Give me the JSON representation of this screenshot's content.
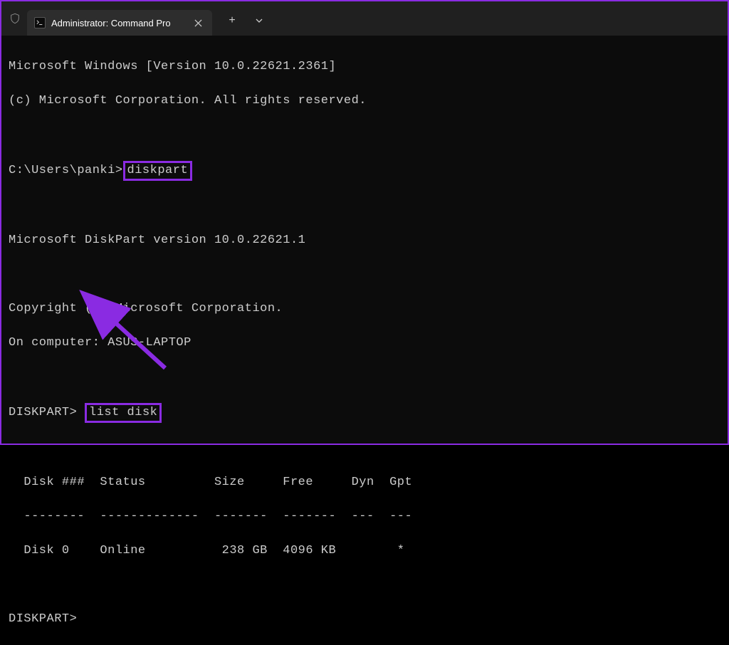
{
  "window": {
    "tab_title": "Administrator: Command Pro",
    "new_tab_symbol": "+",
    "dropdown_symbol": "⌄",
    "close_symbol": "✕"
  },
  "terminal": {
    "line1": "Microsoft Windows [Version 10.0.22621.2361]",
    "line2": "(c) Microsoft Corporation. All rights reserved.",
    "prompt1_path": "C:\\Users\\panki>",
    "prompt1_cmd": "diskpart",
    "diskpart_version": "Microsoft DiskPart version 10.0.22621.1",
    "copyright": "Copyright (C) Microsoft Corporation.",
    "computer": "On computer: ASUS-LAPTOP",
    "prompt2_label": "DISKPART>",
    "prompt2_cmd": "list disk",
    "table_header": "  Disk ###  Status         Size     Free     Dyn  Gpt",
    "table_divider": "  --------  -------------  -------  -------  ---  ---",
    "table_row0": "  Disk 0    Online          238 GB  4096 KB        *",
    "prompt3_label": "DISKPART>",
    "disk_table_data": {
      "columns": [
        "Disk ###",
        "Status",
        "Size",
        "Free",
        "Dyn",
        "Gpt"
      ],
      "rows": [
        {
          "disk": "Disk 0",
          "status": "Online",
          "size": "238 GB",
          "free": "4096 KB",
          "dyn": "",
          "gpt": "*"
        }
      ]
    }
  },
  "annotations": {
    "highlight_color": "#8a2be2",
    "arrow_color": "#8a2be2"
  }
}
